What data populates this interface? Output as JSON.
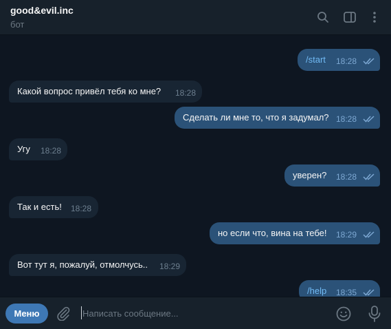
{
  "chat": {
    "title": "good&evil.inc",
    "status": "бот"
  },
  "header_icons": [
    "search-icon",
    "sidebar-toggle-icon",
    "more-vertical-icon"
  ],
  "messages": [
    {
      "dir": "out",
      "text": "/start",
      "time": "18:28",
      "command": true,
      "read": true
    },
    {
      "dir": "in",
      "text": "Какой вопрос привёл тебя ко мне?",
      "time": "18:28"
    },
    {
      "dir": "out",
      "text": "Сделать ли мне то, что я задумал?",
      "time": "18:28",
      "read": true
    },
    {
      "dir": "in",
      "text": "Угу",
      "time": "18:28"
    },
    {
      "dir": "out",
      "text": "уверен?",
      "time": "18:28",
      "read": true
    },
    {
      "dir": "in",
      "text": "Так и есть!",
      "time": "18:28"
    },
    {
      "dir": "out",
      "text": "но если что, вина на тебе!",
      "time": "18:29",
      "read": true
    },
    {
      "dir": "in",
      "text": "Вот тут я, пожалуй, отмолчусь..",
      "time": "18:29"
    },
    {
      "dir": "out",
      "text": "/help",
      "time": "18:35",
      "command": true,
      "read": true
    }
  ],
  "composer": {
    "menu_label": "Меню",
    "placeholder": "Написать сообщение...",
    "value": ""
  },
  "colors": {
    "background": "#0e1621",
    "header": "#17212b",
    "incoming_bubble": "#182533",
    "outgoing_bubble": "#2b5278",
    "accent": "#3e78b5",
    "command_link": "#71baf4"
  }
}
